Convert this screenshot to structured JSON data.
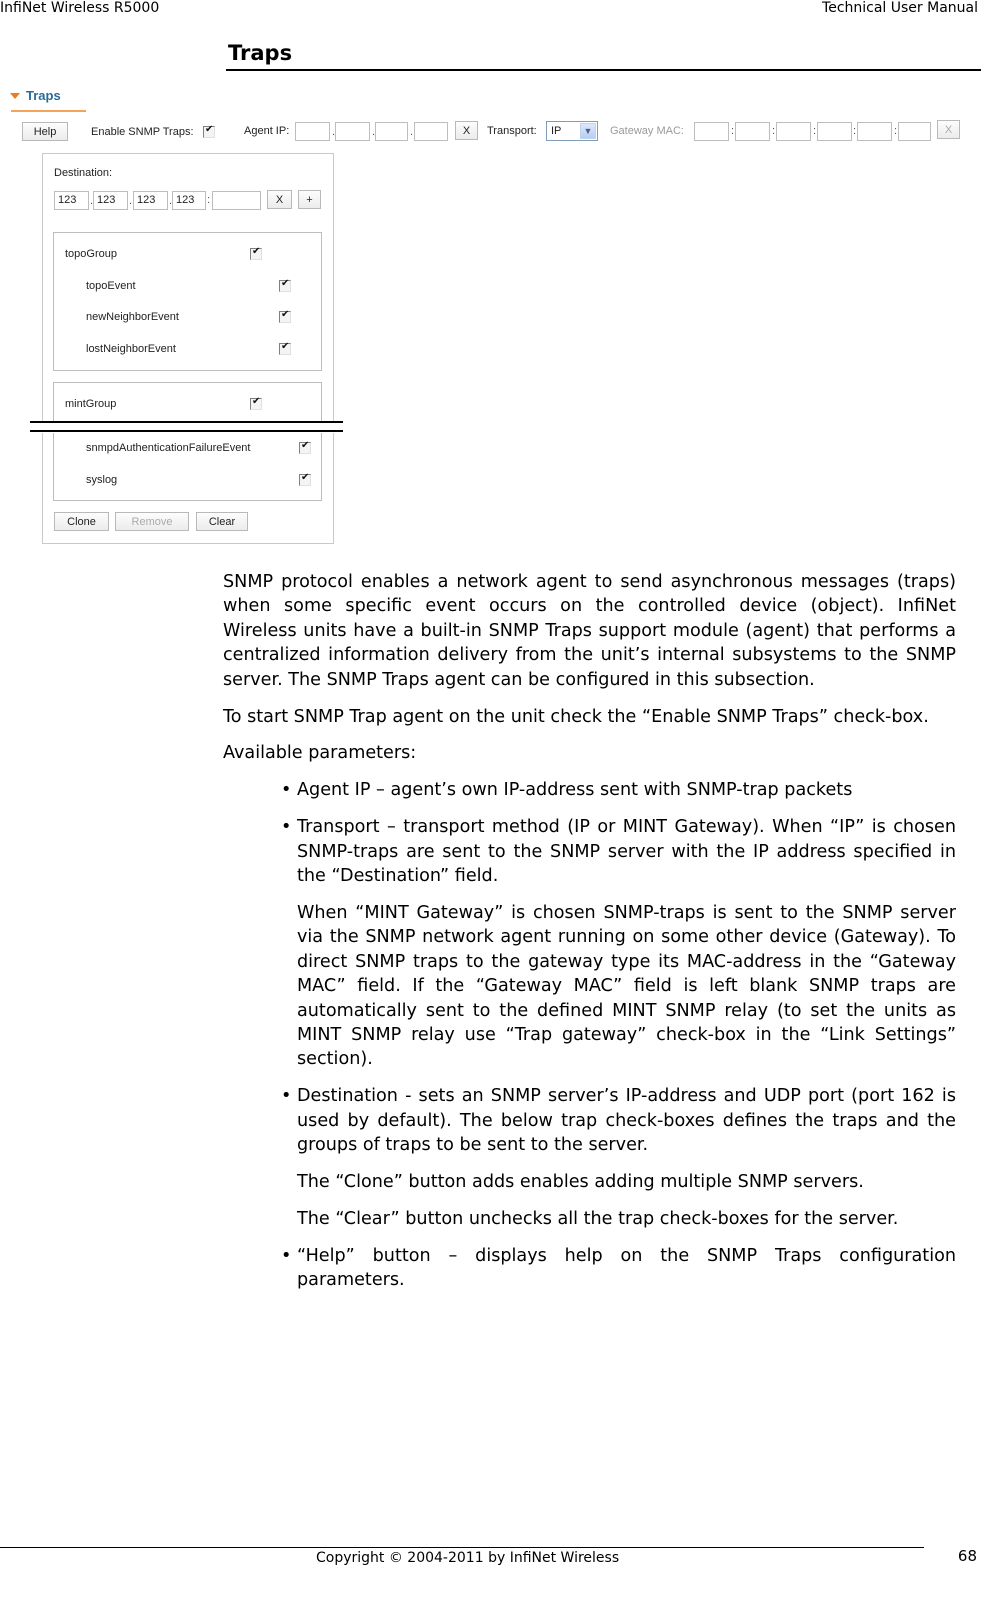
{
  "header": {
    "left": "InfiNet Wireless R5000",
    "right": "Technical User Manual"
  },
  "section_title": "Traps",
  "ui": {
    "panel_title": "Traps",
    "help_button": "Help",
    "enable_label": "Enable SNMP Traps:",
    "enable_checked": true,
    "agent_ip_label": "Agent IP:",
    "agent_ip": [
      "",
      "",
      "",
      ""
    ],
    "clear_x": "X",
    "transport_label": "Transport:",
    "transport_value": "IP",
    "gateway_mac_label": "Gateway MAC:",
    "gateway_mac": [
      "",
      "",
      "",
      "",
      "",
      ""
    ],
    "ip_sep": ".",
    "mac_sep": ":",
    "port_sep": ":",
    "destination_label": "Destination:",
    "destination_ip": [
      "123",
      "123",
      "123",
      "123"
    ],
    "destination_port": "",
    "add_button": "+",
    "groups": [
      {
        "name": "topoGroup",
        "checked": true,
        "events": [
          {
            "name": "topoEvent",
            "checked": true
          },
          {
            "name": "newNeighborEvent",
            "checked": true
          },
          {
            "name": "lostNeighborEvent",
            "checked": true
          }
        ]
      },
      {
        "name": "mintGroup",
        "checked": true,
        "events": [
          {
            "name": "snmpdAuthenticationFailureEvent",
            "checked": true
          },
          {
            "name": "syslog",
            "checked": true
          }
        ]
      }
    ],
    "clone_button": "Clone",
    "remove_button": "Remove",
    "clear_button": "Clear"
  },
  "body": {
    "p1": "SNMP protocol enables a network agent to send asynchronous messages (traps) when some specific event occurs on the controlled device (object). InfiNet Wireless units have a built-in SNMP Traps support module (agent) that performs a centralized information delivery from the unit’s internal subsystems to the SNMP server. The SNMP Traps agent can be configured in this subsection.",
    "p2": "To start SNMP Trap agent on the unit check the “Enable SNMP Traps” check-box.",
    "p3": "Available parameters:",
    "bullet": "•",
    "items": [
      {
        "text": "Agent IP – agent’s own IP-address sent with SNMP-trap packets"
      },
      {
        "text": "Transport – transport method (IP or MINT Gateway). When “IP” is chosen SNMP-traps are sent to the SNMP server with the IP address specified in the “Destination” field.",
        "sub": [
          "When “MINT Gateway” is chosen SNMP-traps is sent to the SNMP server via the SNMP network agent running on some other device (Gateway). To direct SNMP traps to the gateway type its MAC-address in the “Gateway MAC” field. If the “Gateway MAC” field is left blank SNMP traps are automatically sent to the defined MINT SNMP relay (to set the units as MINT SNMP relay use “Trap gateway” check-box in the “Link Settings” section)."
        ]
      },
      {
        "text": "Destination - sets an SNMP server’s IP-address and UDP port (port 162 is used by default). The below trap check-boxes defines the traps and the groups of traps to be sent to the server.",
        "sub": [
          "The “Clone” button adds enables adding multiple SNMP servers.",
          "The “Clear” button unchecks all the trap check-boxes for the server."
        ]
      },
      {
        "text": "“Help” button – displays help on the SNMP Traps configuration parameters."
      }
    ]
  },
  "footer": {
    "copyright": "Copyright © 2004-2011 by InfiNet Wireless",
    "page_number": "68"
  }
}
